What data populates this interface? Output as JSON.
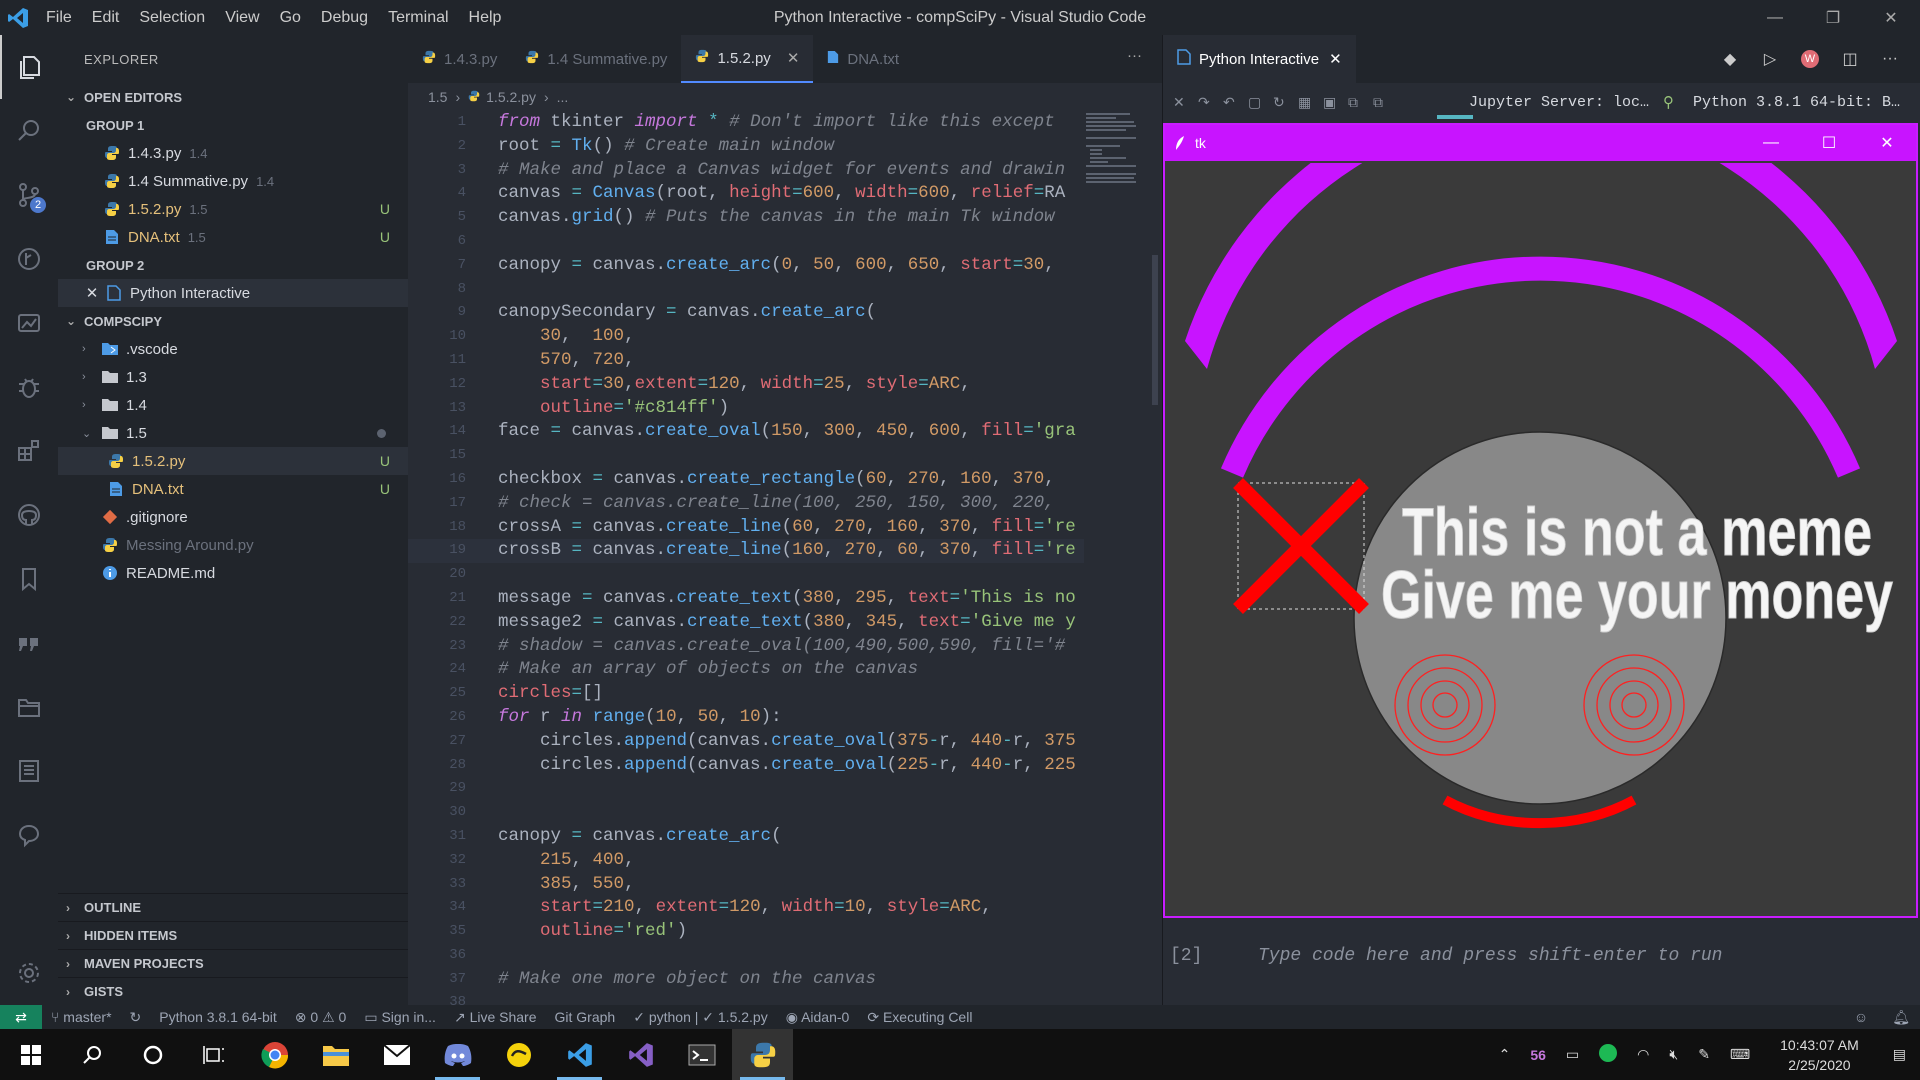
{
  "window": {
    "title": "Python Interactive - compSciPy - Visual Studio Code",
    "menu": [
      "File",
      "Edit",
      "Selection",
      "View",
      "Go",
      "Debug",
      "Terminal",
      "Help"
    ]
  },
  "activity_bar": {
    "scm_badge": "2"
  },
  "explorer": {
    "header": "EXPLORER",
    "open_editors_label": "OPEN EDITORS",
    "group1_label": "GROUP 1",
    "group1": [
      {
        "name": "1.4.3.py",
        "sub": "1.4",
        "status": ""
      },
      {
        "name": "1.4 Summative.py",
        "sub": "1.4",
        "status": ""
      },
      {
        "name": "1.5.2.py",
        "sub": "1.5",
        "status": "U"
      },
      {
        "name": "DNA.txt",
        "sub": "1.5",
        "status": "U"
      }
    ],
    "group2_label": "GROUP 2",
    "group2": [
      {
        "name": "Python Interactive"
      }
    ],
    "workspace_label": "COMPSCIPY",
    "tree": [
      {
        "name": ".vscode",
        "status": ""
      },
      {
        "name": "1.3",
        "status": ""
      },
      {
        "name": "1.4",
        "status": ""
      },
      {
        "name": "1.5",
        "status": ""
      },
      {
        "name": "1.5.2.py",
        "status": "U"
      },
      {
        "name": "DNA.txt",
        "status": "U"
      },
      {
        "name": ".gitignore",
        "status": ""
      },
      {
        "name": "Messing Around.py",
        "status": ""
      },
      {
        "name": "README.md",
        "status": ""
      }
    ],
    "bottom_sections": [
      "OUTLINE",
      "HIDDEN ITEMS",
      "MAVEN PROJECTS",
      "GISTS"
    ]
  },
  "editor": {
    "tabs": [
      {
        "label": "1.4.3.py"
      },
      {
        "label": "1.4 Summative.py"
      },
      {
        "label": "1.5.2.py"
      },
      {
        "label": "DNA.txt"
      }
    ],
    "breadcrumb": [
      "1.5",
      "1.5.2.py",
      "..."
    ],
    "line_numbers": [
      "1",
      "2",
      "3",
      "4",
      "5",
      "6",
      "7",
      "8",
      "9",
      "10",
      "11",
      "12",
      "13",
      "14",
      "15",
      "16",
      "17",
      "18",
      "19",
      "20",
      "21",
      "22",
      "23",
      "24",
      "25",
      "26",
      "27",
      "28",
      "29",
      "30",
      "31",
      "32",
      "33",
      "34",
      "35",
      "36",
      "37",
      "38"
    ],
    "code_lines": [
      "from tkinter import * # Don't import like this except",
      "root = Tk() # Create main window",
      "# Make and place a Canvas widget for events and drawin",
      "canvas = Canvas(root, height=600, width=600, relief=RA",
      "canvas.grid() # Puts the canvas in the main Tk window",
      "",
      "canopy = canvas.create_arc(0, 50, 600, 650, start=30, ",
      "",
      "canopySecondary = canvas.create_arc(",
      "    30,  100,",
      "    570, 720,",
      "    start=30,extent=120, width=25, style=ARC,",
      "    outline='#c814ff')",
      "face = canvas.create_oval(150, 300, 450, 600, fill='gra",
      "",
      "checkbox = canvas.create_rectangle(60, 270, 160, 370, ",
      "# check = canvas.create_line(100, 250, 150, 300, 220, ",
      "crossA = canvas.create_line(60, 270, 160, 370, fill='re",
      "crossB = canvas.create_line(160, 270, 60, 370, fill='re",
      "",
      "message = canvas.create_text(380, 295, text='This is no",
      "message2 = canvas.create_text(380, 345, text='Give me y",
      "# shadow = canvas.create_oval(100,490,500,590, fill='#",
      "# Make an array of objects on the canvas",
      "circles=[]",
      "for r in range(10, 50, 10):",
      "    circles.append(canvas.create_oval(375-r, 440-r, 375",
      "    circles.append(canvas.create_oval(225-r, 440-r, 225",
      "",
      "",
      "canopy = canvas.create_arc(",
      "    215, 400,",
      "    385, 550,",
      "    start=210, extent=120, width=10, style=ARC,",
      "    outline='red')",
      "",
      "# Make one more object on the canvas",
      ""
    ]
  },
  "interactive": {
    "tab_label": "Python Interactive",
    "jupyter_server": "Jupyter Server: loc…",
    "kernel": "Python 3.8.1 64-bit: B…",
    "cell_count": "[2]",
    "input_placeholder": "Type code here and press shift-enter to run"
  },
  "tk_window": {
    "title": "tk",
    "message1": "This is not a meme",
    "message2": "Give me your money",
    "colors": {
      "canvas_bg": "#3a3a3a",
      "arc": "#c814ff",
      "cross": "#ff0000",
      "face": "#888888",
      "title_bar": "#c814ff"
    }
  },
  "statusbar": {
    "branch": "master*",
    "python": "Python 3.8.1 64-bit",
    "problems": "⊗ 0 ⚠ 0",
    "sign_in": "Sign in...",
    "live_share": "Live Share",
    "git_graph": "Git Graph",
    "lang": "✓ python | ✓ 1.5.2.py",
    "user": "Aidan-0",
    "executing": "Executing Cell"
  },
  "taskbar": {
    "tray_number": "56",
    "time": "10:43:07 AM",
    "date": "2/25/2020"
  }
}
